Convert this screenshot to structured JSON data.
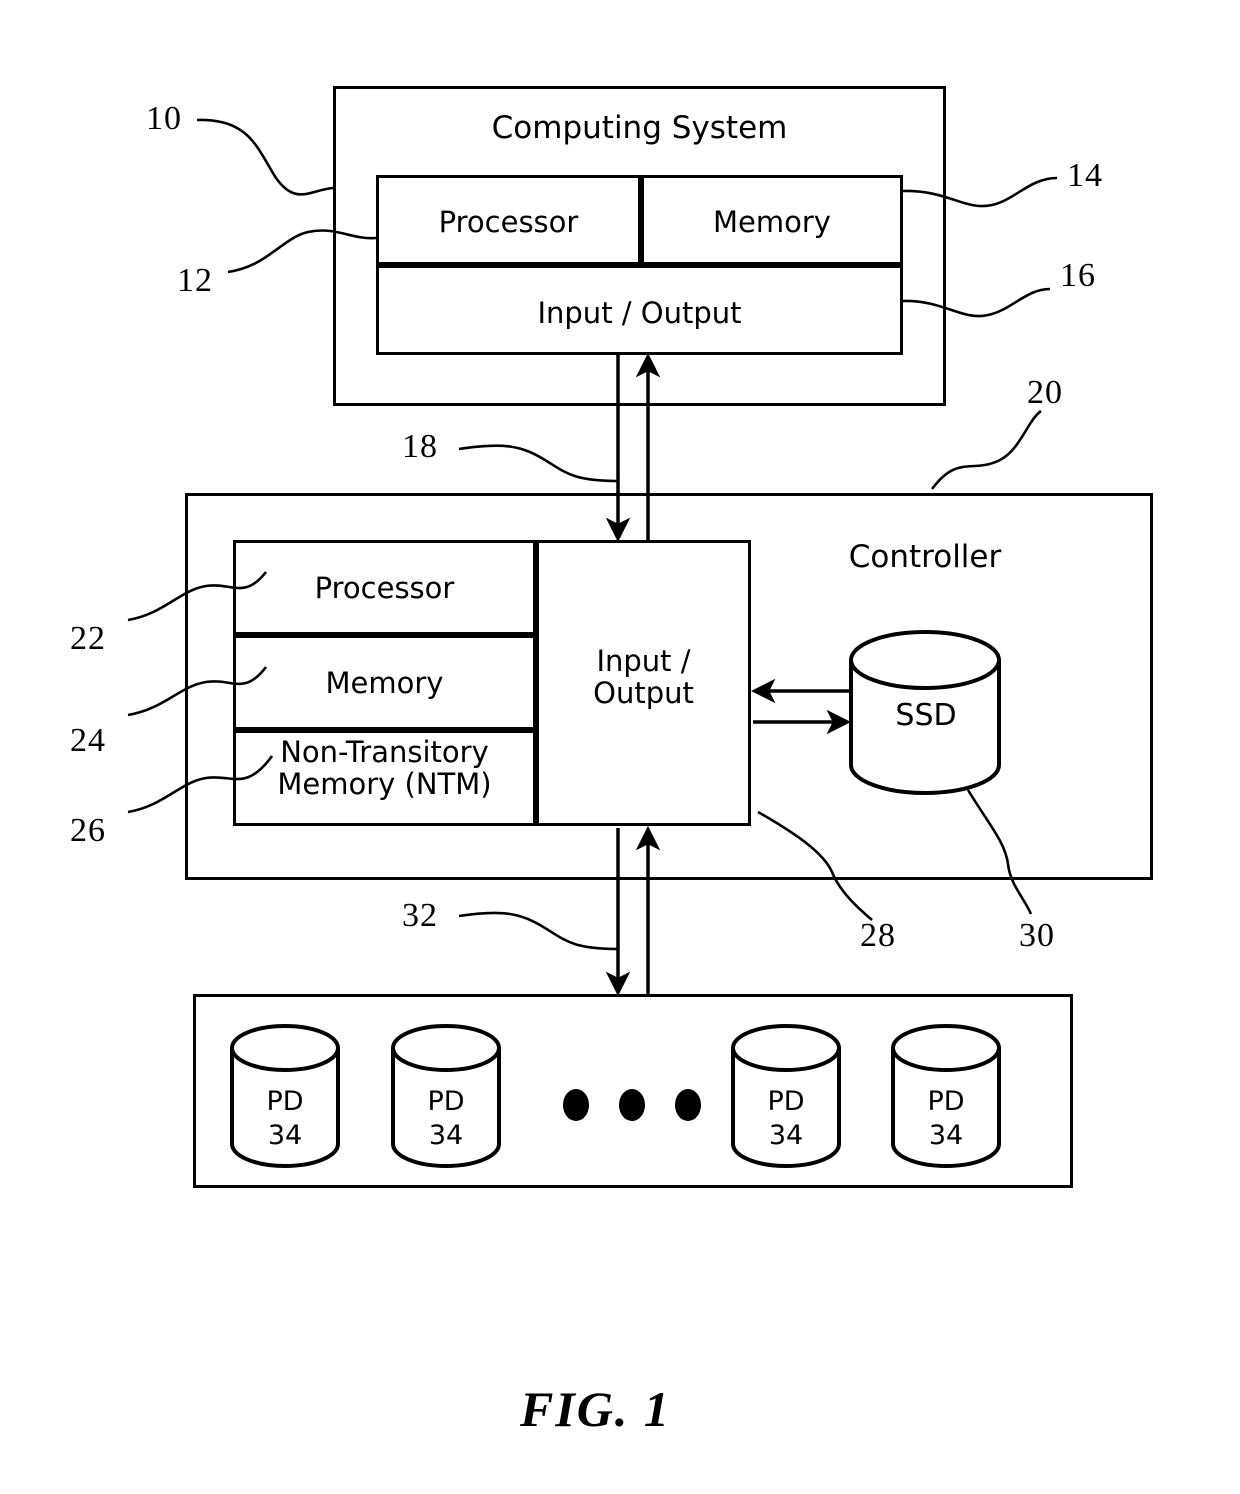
{
  "figure": {
    "caption": "FIG. 1",
    "computing_system": {
      "title": "Computing System",
      "ref": "10",
      "blocks": [
        {
          "label": "Processor",
          "ref": "12"
        },
        {
          "label": "Memory",
          "ref": "14"
        },
        {
          "label": "Input / Output",
          "ref": "16"
        }
      ]
    },
    "bus_top": {
      "ref": "18"
    },
    "controller": {
      "title": "Controller",
      "ref": "20",
      "blocks": [
        {
          "label": "Processor",
          "ref": "22"
        },
        {
          "label": "Memory",
          "ref": "24"
        },
        {
          "label": "Non-Transitory\nMemory (NTM)",
          "ref": "26"
        },
        {
          "label": "Input /\nOutput",
          "ref": "28"
        }
      ],
      "ssd": {
        "label": "SSD",
        "ref": "30"
      }
    },
    "bus_bottom": {
      "ref": "32"
    },
    "disk_array": {
      "disks": [
        {
          "label": "PD",
          "ref": "34"
        },
        {
          "label": "PD",
          "ref": "34"
        },
        {
          "label": "PD",
          "ref": "34"
        },
        {
          "label": "PD",
          "ref": "34"
        }
      ],
      "ellipsis_dots": 3
    }
  },
  "colors": {
    "stroke": "#000000",
    "background": "#ffffff"
  }
}
